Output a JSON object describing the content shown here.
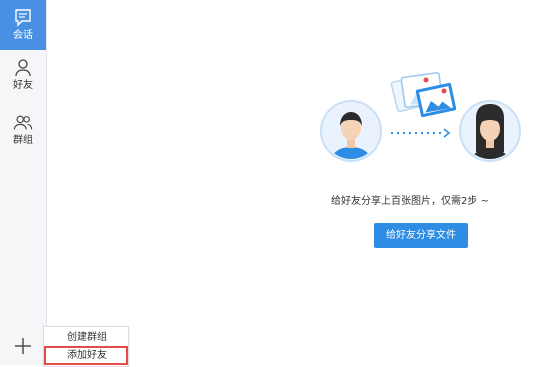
{
  "sidebar": {
    "items": [
      {
        "label": "会话",
        "icon": "chat-icon",
        "active": true
      },
      {
        "label": "好友",
        "icon": "person-icon",
        "active": false
      },
      {
        "label": "群组",
        "icon": "group-icon",
        "active": false
      }
    ],
    "add_icon": "plus-icon"
  },
  "popup_menu": {
    "items": [
      {
        "label": "创建群组"
      },
      {
        "label": "添加好友",
        "highlighted": true
      }
    ]
  },
  "main": {
    "caption": "给好友分享上百张图片，仅需2步 ~",
    "share_button": "给好友分享文件"
  },
  "colors": {
    "accent": "#2d8ce3",
    "sidebar_active": "#4a90e2",
    "highlight_border": "#e34a4a"
  }
}
